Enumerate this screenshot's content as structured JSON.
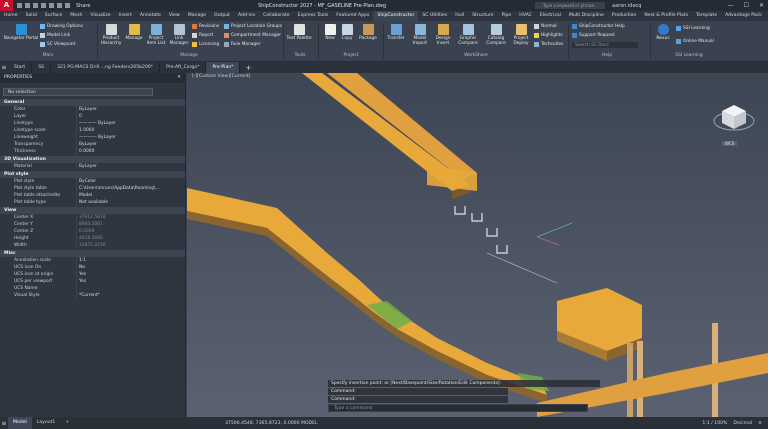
{
  "titlebar": {
    "logo": "A",
    "share": "Share",
    "doc_title": "ShipConstructor 2027 - MF_GASELINE   Pre-Plan.dwg",
    "search_placeholder": "Type a keyword or phrase",
    "user": "aaron.idecq",
    "minimize": "—",
    "maximize": "☐",
    "close": "✕"
  },
  "menu_tabs": [
    "Home",
    "Solid",
    "Surface",
    "Mesh",
    "Visualize",
    "Insert",
    "Annotate",
    "View",
    "Manage",
    "Output",
    "Add-ins",
    "Collaborate",
    "Express Tools",
    "Featured Apps",
    "ShipConstructor",
    "SC Utilities",
    "Hull",
    "Structure",
    "Pipe",
    "HVAC",
    "Electrical",
    "Multi Discipline",
    "Production",
    "Nest & Profile Plots",
    "Template",
    "Advantage Pack"
  ],
  "active_menu_tab": "ShipConstructor",
  "ribbon": {
    "main": {
      "title": "Main",
      "navigator": "Navigator Portal",
      "drawing_options": "Drawing Options",
      "model_link": "Model Link",
      "sc_viewpoint": "SC Viewpoint"
    },
    "manage": {
      "title": "Manage",
      "product_hierarchy": "Product Hierarchy",
      "manage": "Manage",
      "project_item_list": "Project Item List",
      "link_manager": "Link Manager",
      "revisions": "Revisions",
      "report": "Report",
      "licensing": "Licensing",
      "project_location_groups": "Project Location Groups",
      "compartment_manager": "Compartment Manager",
      "rule_manager": "Rule Manager"
    },
    "tools": {
      "title": "Tools",
      "text_palette": "Text Palette"
    },
    "project": {
      "title": "Project",
      "new": "New",
      "copy": "Copy",
      "package": "Package"
    },
    "workshare": {
      "title": "WorkShare",
      "transfer": "Transfer",
      "model_import": "Model Import",
      "design_insert": "Design Insert",
      "graphic_compare": "Graphic Compare",
      "catalog_compare": "Catalog Compare",
      "project_deploy": "Project Deploy",
      "normal": "Normal",
      "highlights": "Highlights",
      "techsuites": "Techsuites"
    },
    "help": {
      "title": "Help",
      "sc_help": "ShipConstructor Help",
      "support_request": "Support Request",
      "search_placeholder": "Search SC Docs"
    },
    "ssi_learning": {
      "title": "SSI Learning",
      "nexus": "Nexus",
      "ssi_learning": "SSI Learning",
      "online_manual": "Online Manual"
    }
  },
  "doc_tabs": [
    "Start",
    "SS",
    "321 PG-MACS Drill ...ng Feeders205b206*",
    "Pre-Aft_Cargo*",
    "Pre-Plan*"
  ],
  "active_doc_tab": "Pre-Plan*",
  "properties": {
    "header": "PROPERTIES",
    "selection": "No selection",
    "sections": [
      {
        "title": "General",
        "rows": [
          {
            "k": "Color",
            "v": "ByLayer"
          },
          {
            "k": "Layer",
            "v": "0"
          },
          {
            "k": "Linetype",
            "v": "————  ByLayer"
          },
          {
            "k": "Linetype scale",
            "v": "1.0000"
          },
          {
            "k": "Lineweight",
            "v": "————  ByLayer"
          },
          {
            "k": "Transparency",
            "v": "ByLayer"
          },
          {
            "k": "Thickness",
            "v": "0.0000"
          }
        ]
      },
      {
        "title": "3D Visualization",
        "rows": [
          {
            "k": "Material",
            "v": "ByLayer"
          }
        ]
      },
      {
        "title": "Plot style",
        "rows": [
          {
            "k": "Plot style",
            "v": "ByColor"
          },
          {
            "k": "Plot style table",
            "v": "C:\\Users\\mruns\\AppData\\Roaming\\..."
          },
          {
            "k": "Plot table attachedto",
            "v": "Model"
          },
          {
            "k": "Plot table type",
            "v": "Not available"
          }
        ]
      },
      {
        "title": "View",
        "rows": [
          {
            "k": "Center X",
            "v": "37612.5818"
          },
          {
            "k": "Center Y",
            "v": "8983.3081"
          },
          {
            "k": "Center Z",
            "v": "0.0000"
          },
          {
            "k": "Height",
            "v": "4018.2680"
          },
          {
            "k": "Width",
            "v": "10871.0256"
          }
        ]
      },
      {
        "title": "Misc",
        "rows": [
          {
            "k": "Annotation scale",
            "v": "1:1"
          },
          {
            "k": "UCS icon On",
            "v": "No"
          },
          {
            "k": "UCS icon at origin",
            "v": "Yes"
          },
          {
            "k": "UCS per viewport",
            "v": "Yes"
          },
          {
            "k": "UCS Name",
            "v": ""
          },
          {
            "k": "Visual Style",
            "v": "*Current*"
          }
        ]
      }
    ]
  },
  "viewport": {
    "label": "[-][Custom View][Current]",
    "viewcube_label": "WCS",
    "accent_yellow": "#e8a83a",
    "accent_dark": "#7a5a2a"
  },
  "command": {
    "lines": [
      "Specify insertion point: or [Next/Basepoint/Size/Rotation/Edit Components]:",
      "Command:",
      "Command:"
    ],
    "placeholder": "Type a command"
  },
  "status": {
    "model": "Model",
    "layout": "Layout1",
    "coords": "37506.4548, 7365.8723, 0.0000  MODEL",
    "zoom": "1:1 / 100%",
    "units": "Decimal"
  }
}
